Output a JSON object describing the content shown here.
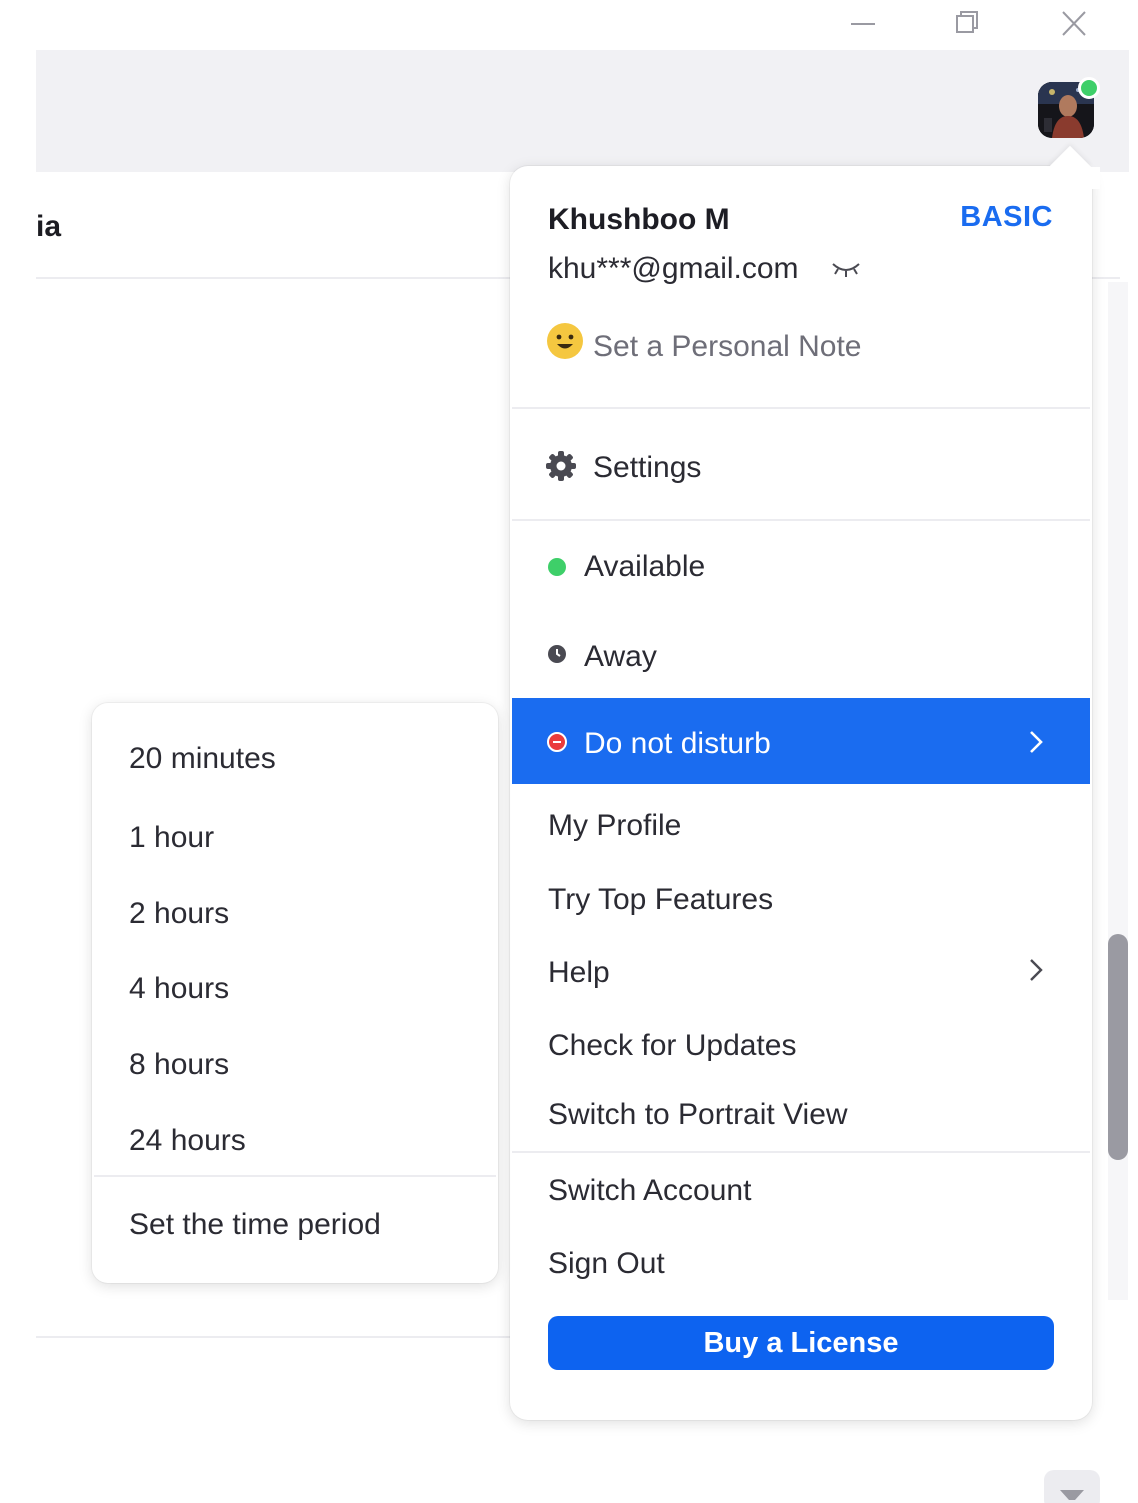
{
  "window": {
    "controls": {
      "minimize": "minimize-icon",
      "restore": "restore-icon",
      "close": "close-icon"
    }
  },
  "background": {
    "title_fragment": "ia"
  },
  "profile_menu": {
    "user_name": "Khushboo M",
    "plan": "BASIC",
    "email": "khu***@gmail.com",
    "personal_note": "Set a Personal Note",
    "settings": "Settings",
    "status": {
      "available": "Available",
      "away": "Away",
      "do_not_disturb": "Do not disturb"
    },
    "items": {
      "my_profile": "My Profile",
      "try_top_features": "Try Top Features",
      "help": "Help",
      "check_for_updates": "Check for Updates",
      "switch_to_portrait_view": "Switch to Portrait View",
      "switch_account": "Switch Account",
      "sign_out": "Sign Out"
    },
    "buy_license": "Buy a License"
  },
  "dnd_submenu": {
    "options": [
      "20 minutes",
      "1 hour",
      "2 hours",
      "4 hours",
      "8 hours",
      "24 hours"
    ],
    "set_time_period": "Set the time period"
  },
  "colors": {
    "accent": "#1a6cf0",
    "button": "#0d63f0",
    "available": "#3ecf69",
    "dnd": "#ea3c3c",
    "away": "#4a4a52"
  }
}
